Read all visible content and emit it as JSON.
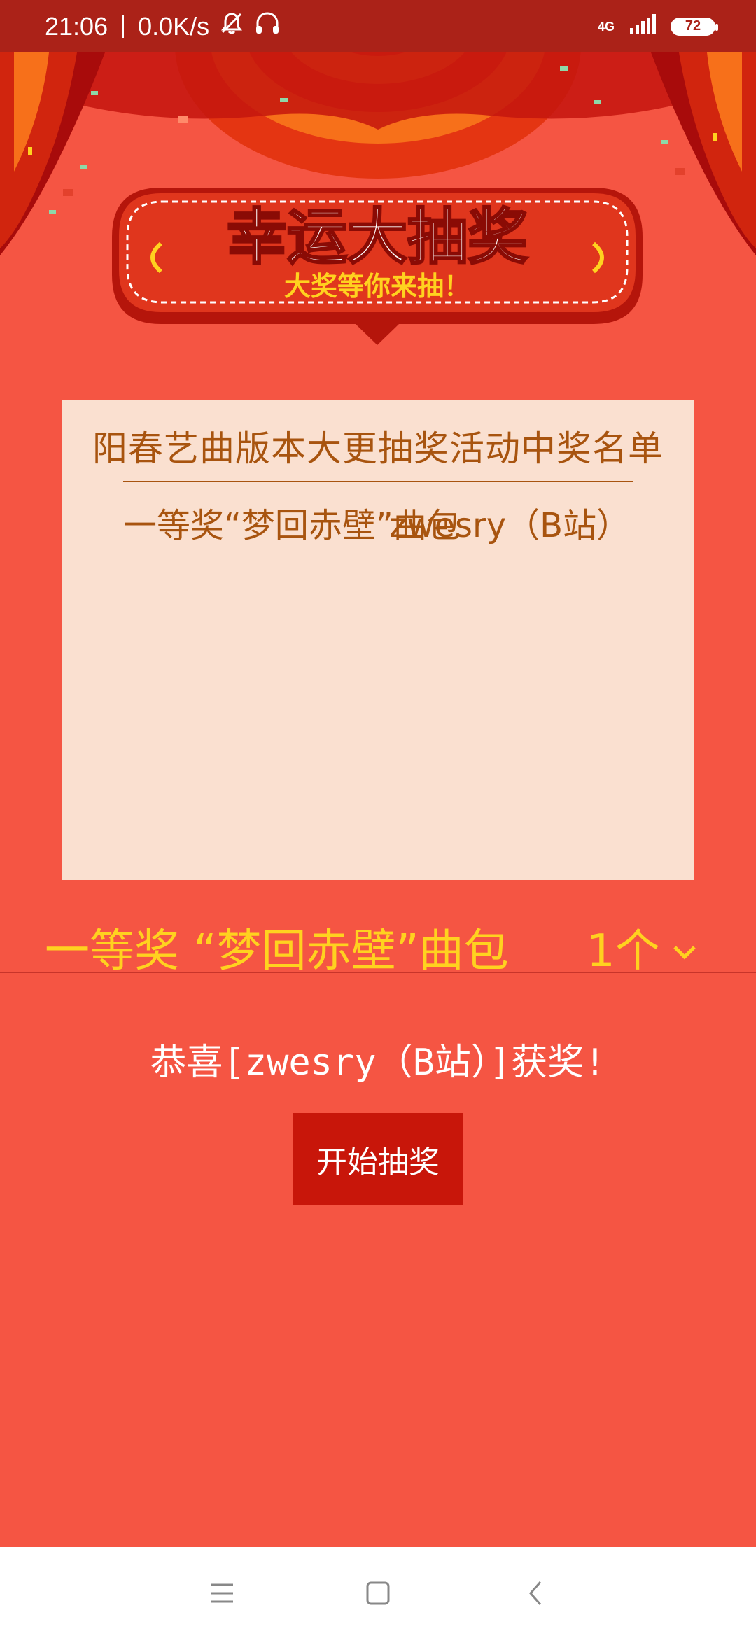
{
  "status_bar": {
    "time": "21:06",
    "speed": "0.0K/s",
    "network_type": "4G",
    "battery": "72",
    "icons": [
      "mute-bell-icon",
      "headphones-icon",
      "signal-icon",
      "battery-icon"
    ]
  },
  "banner": {
    "title": "幸运大抽奖",
    "subtitle": "大奖等你来抽！"
  },
  "winners": {
    "title": "阳春艺曲版本大更抽奖活动中奖名单",
    "entries": [
      {
        "prize": "一等奖“梦回赤壁”曲包",
        "winner": "zwesry（B站）"
      }
    ]
  },
  "prize_select": {
    "name": "一等奖 “梦回赤壁”曲包",
    "count": "1个",
    "icon": "chevron-down-icon"
  },
  "congrats": "恭喜[zwesry（B站）]获奖!",
  "start_button": "开始抽奖",
  "colors": {
    "background": "#f55543",
    "status_bar": "#ab2218",
    "panel": "#fae0d0",
    "panel_text": "#a8540f",
    "prize_text": "#ffd21f",
    "button": "#c8160a"
  }
}
